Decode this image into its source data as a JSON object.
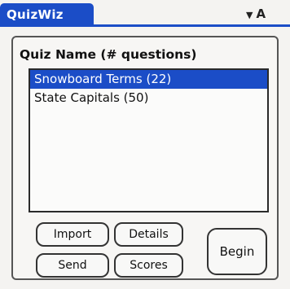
{
  "app": {
    "title": "QuizWiz"
  },
  "category": {
    "label": "A",
    "arrow_icon": "triangle-down-icon"
  },
  "quiz_list": {
    "header": "Quiz Name (# questions)",
    "items": [
      {
        "label": "Snowboard Terms (22)",
        "selected": true
      },
      {
        "label": "State Capitals (50)",
        "selected": false
      }
    ]
  },
  "buttons": {
    "import": "Import",
    "details": "Details",
    "send": "Send",
    "scores": "Scores",
    "begin": "Begin"
  },
  "colors": {
    "accent": "#1b4dc7"
  }
}
